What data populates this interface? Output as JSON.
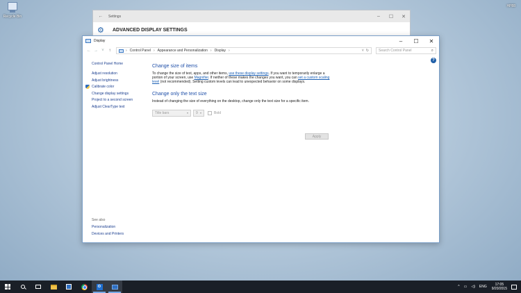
{
  "desktop": {
    "icon_label": "Recycle Bin",
    "corner_text": "HP88"
  },
  "settings_window": {
    "title": "Settings",
    "header": "ADVANCED DISPLAY SETTINGS",
    "back_glyph": "←",
    "min_glyph": "–",
    "max_glyph": "☐",
    "close_glyph": "✕"
  },
  "display_window": {
    "title": "Display",
    "min_glyph": "–",
    "max_glyph": "☐",
    "close_glyph": "✕"
  },
  "address_bar": {
    "back_glyph": "←",
    "forward_glyph": "→",
    "recent_glyph": "˅",
    "up_glyph": "↑",
    "crumbs": [
      "Control Panel",
      "Appearance and Personalization",
      "Display"
    ],
    "separator": "›",
    "root_sep": "›",
    "dropdown_glyph": "˅",
    "refresh_glyph": "↻",
    "search_placeholder": "Search Control Panel",
    "search_glyph": "⌕"
  },
  "help_glyph": "?",
  "sidebar": {
    "home": "Control Panel Home",
    "items": [
      "Adjust resolution",
      "Adjust brightness",
      "Calibrate color",
      "Change display settings",
      "Project to a second screen",
      "Adjust ClearType text"
    ],
    "see_also": "See also",
    "see_also_items": [
      "Personalization",
      "Devices and Printers"
    ]
  },
  "content": {
    "heading1": "Change size of items",
    "para1_part1": "To change the size of text, apps, and other items,",
    "para1_link1": "use these display settings",
    "para1_part2": ". If you want to temporarily enlarge a portion of your screen, use",
    "para1_link2": "Magnifier",
    "para1_part3": ". If neither of these makes the changes you want, you can",
    "para1_link3": "set a custom scaling level",
    "para1_part4": "(not recommended). Setting custom levels can lead to unexpected behavior on some displays.",
    "heading2": "Change only the text size",
    "para2": "Instead of changing the size of everything on the desktop, change only the text size for a specific item.",
    "item_select": "Title bars",
    "size_select": "9",
    "dropdown_glyph": "▾",
    "bold_label": "Bold",
    "apply_label": "Apply"
  },
  "taskbar": {
    "settings_glyph": "⚙",
    "tray": {
      "chevron": "^",
      "network": "▭",
      "volume": "◁)",
      "language": "ENG",
      "time": "17:05",
      "date": "9/20/2015"
    }
  }
}
